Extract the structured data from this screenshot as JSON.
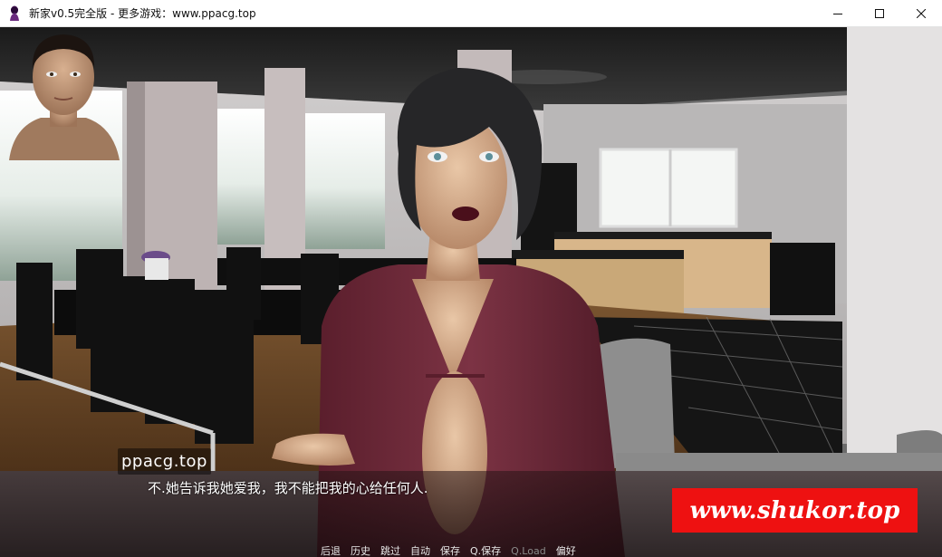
{
  "window": {
    "title": "新家v0.5完全版 - 更多游戏：www.ppacg.top",
    "controls": [
      "minimize",
      "maximize",
      "close"
    ]
  },
  "dialogue": {
    "speaker": "ppacg.top",
    "text": "不.她告诉我她爱我，我不能把我的心给任何人."
  },
  "watermark": {
    "text": "www.shukor.top",
    "color": "#ee1111"
  },
  "quick_menu": {
    "back": "后退",
    "history": "历史",
    "skip": "跳过",
    "auto": "自动",
    "save": "保存",
    "quick_save": "Q.保存",
    "quick_load": "Q.Load",
    "preferences": "偏好"
  },
  "colors": {
    "dialog_bg": "#2a1416",
    "dress": "#6e2a3a",
    "quick_menu_disabled": "#8a8a8a"
  }
}
